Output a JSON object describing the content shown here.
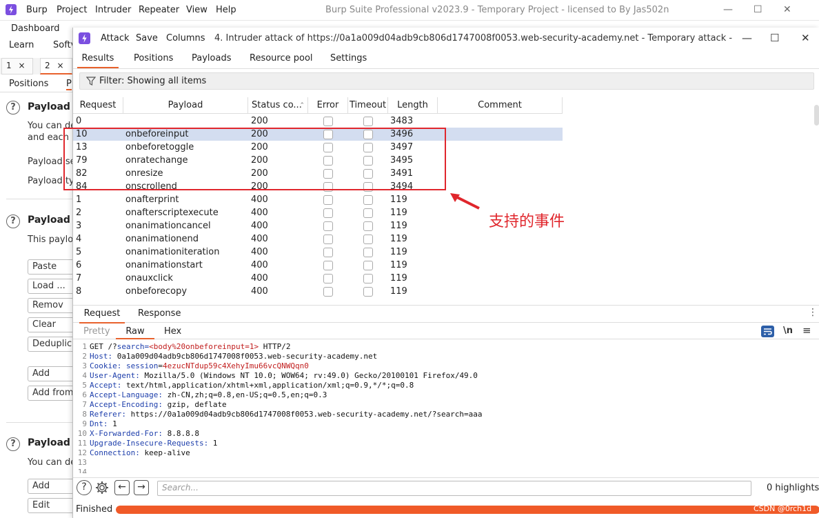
{
  "main_window": {
    "menu": [
      "Burp",
      "Project",
      "Intruder",
      "Repeater",
      "View",
      "Help"
    ],
    "title": "Burp Suite Professional v2023.9 - Temporary Project - licensed to By Jas502n",
    "nav": [
      "Dashboard",
      "Learn",
      "Softv"
    ],
    "tabs": [
      "1",
      "2"
    ],
    "tab_close": "×",
    "subtabs": [
      "Positions",
      "P"
    ]
  },
  "bg_panel": {
    "section1_title": "Payload s",
    "section1_text1": "You can de",
    "section1_text2": "and each p",
    "payload_set_label": "Payload se",
    "payload_type_label": "Payload typ",
    "section2_title": "Payload s",
    "section2_text": "This payloa",
    "buttons": [
      "Paste",
      "Load ...",
      "Remov",
      "Clear",
      "Deduplic",
      "Add",
      "Add from"
    ],
    "section3_title": "Payload p",
    "section3_text": "You can de",
    "buttons2": [
      "Add",
      "Edit"
    ]
  },
  "attack_window": {
    "menu": [
      "Attack",
      "Save",
      "Columns"
    ],
    "title": "4. Intruder attack of https://0a1a009d04adb9cb806d1747008f0053.web-security-academy.net - Temporary attack - Not saved t...",
    "tabs": [
      "Results",
      "Positions",
      "Payloads",
      "Resource pool",
      "Settings"
    ],
    "filter": "Filter: Showing all items"
  },
  "table": {
    "columns": [
      "Request",
      "Payload",
      "Status co...",
      "Error",
      "Timeout",
      "Length",
      "Comment"
    ],
    "rows": [
      {
        "request": "0",
        "payload": "",
        "status": "200",
        "length": "3483"
      },
      {
        "request": "10",
        "payload": "onbeforeinput",
        "status": "200",
        "length": "3496"
      },
      {
        "request": "13",
        "payload": "onbeforetoggle",
        "status": "200",
        "length": "3497"
      },
      {
        "request": "79",
        "payload": "onratechange",
        "status": "200",
        "length": "3495"
      },
      {
        "request": "82",
        "payload": "onresize",
        "status": "200",
        "length": "3491"
      },
      {
        "request": "84",
        "payload": "onscrollend",
        "status": "200",
        "length": "3494"
      },
      {
        "request": "1",
        "payload": "onafterprint",
        "status": "400",
        "length": "119"
      },
      {
        "request": "2",
        "payload": "onafterscriptexecute",
        "status": "400",
        "length": "119"
      },
      {
        "request": "3",
        "payload": "onanimationcancel",
        "status": "400",
        "length": "119"
      },
      {
        "request": "4",
        "payload": "onanimationend",
        "status": "400",
        "length": "119"
      },
      {
        "request": "5",
        "payload": "onanimationiteration",
        "status": "400",
        "length": "119"
      },
      {
        "request": "6",
        "payload": "onanimationstart",
        "status": "400",
        "length": "119"
      },
      {
        "request": "7",
        "payload": "onauxclick",
        "status": "400",
        "length": "119"
      },
      {
        "request": "8",
        "payload": "onbeforecopy",
        "status": "400",
        "length": "119"
      }
    ],
    "selected_request": "10"
  },
  "annotation": {
    "label": "支持的事件"
  },
  "request_response": {
    "tabs": [
      "Request",
      "Response"
    ],
    "view_tabs": [
      "Pretty",
      "Raw",
      "Hex"
    ],
    "lines": [
      [
        {
          "t": "GET /?"
        },
        {
          "t": "search",
          "c": "k"
        },
        {
          "t": "=",
          "c": "k"
        },
        {
          "t": "<body%20onbeforeinput=1>",
          "c": "r"
        },
        {
          "t": " HTTP/2"
        }
      ],
      [
        {
          "t": "Host:",
          "c": "k"
        },
        {
          "t": " 0a1a009d04adb9cb806d1747008f0053.web-security-academy.net"
        }
      ],
      [
        {
          "t": "Cookie:",
          "c": "k"
        },
        {
          "t": " "
        },
        {
          "t": "session",
          "c": "k"
        },
        {
          "t": "="
        },
        {
          "t": "4ezucNTdup59c4XehyImu66vcQNWQqn0",
          "c": "r"
        }
      ],
      [
        {
          "t": "User-Agent:",
          "c": "k"
        },
        {
          "t": " Mozilla/5.0 (Windows NT 10.0; WOW64; rv:49.0) Gecko/20100101 Firefox/49.0"
        }
      ],
      [
        {
          "t": "Accept:",
          "c": "k"
        },
        {
          "t": " text/html,application/xhtml+xml,application/xml;q=0.9,*/*;q=0.8"
        }
      ],
      [
        {
          "t": "Accept-Language:",
          "c": "k"
        },
        {
          "t": " zh-CN,zh;q=0.8,en-US;q=0.5,en;q=0.3"
        }
      ],
      [
        {
          "t": "Accept-Encoding:",
          "c": "k"
        },
        {
          "t": " gzip, deflate"
        }
      ],
      [
        {
          "t": "Referer:",
          "c": "k"
        },
        {
          "t": " https://0a1a009d04adb9cb806d1747008f0053.web-security-academy.net/?search=aaa"
        }
      ],
      [
        {
          "t": "Dnt:",
          "c": "k"
        },
        {
          "t": " 1"
        }
      ],
      [
        {
          "t": "X-Forwarded-For:",
          "c": "k"
        },
        {
          "t": " 8.8.8.8"
        }
      ],
      [
        {
          "t": "Upgrade-Insecure-Requests:",
          "c": "k"
        },
        {
          "t": " 1"
        }
      ],
      [
        {
          "t": "Connection:",
          "c": "k"
        },
        {
          "t": " keep-alive"
        }
      ],
      [],
      []
    ]
  },
  "bottom": {
    "search_placeholder": "Search...",
    "highlights": "0 highlights",
    "status": "Finished",
    "progress": 1.0
  },
  "watermark": "CSDN @0rch1d",
  "colors": {
    "accent": "#e8612c",
    "annotation": "#e0262c",
    "selection": "#d3ddf0",
    "progress": "#f05a28"
  }
}
